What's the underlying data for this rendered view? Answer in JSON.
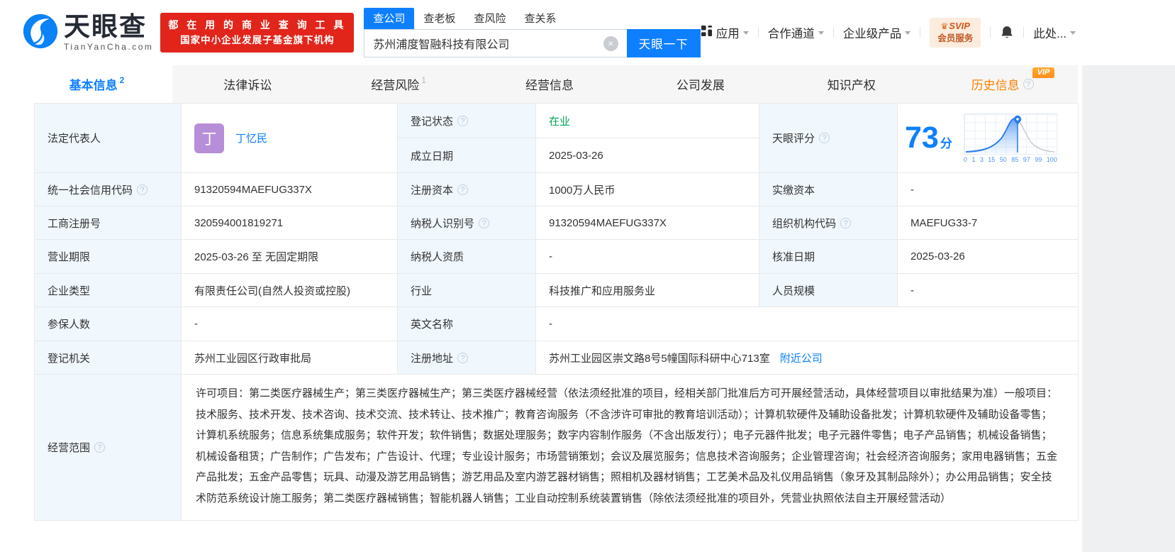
{
  "header": {
    "brand": {
      "name": "天眼查",
      "domain": "TianYanCha.com"
    },
    "promo": {
      "line1": "都 在 用 的 商 业 查 询 工 具",
      "line2": "国家中小企业发展子基金旗下机构"
    },
    "search": {
      "tab_company": "查公司",
      "tab_boss": "查老板",
      "tab_risk": "查风险",
      "tab_relation": "查关系",
      "value": "苏州浦度智融科技有限公司",
      "button": "天眼一下"
    },
    "nav": {
      "apps": "应用",
      "partner": "合作通道",
      "enterprise": "企业级产品",
      "svip_top": "SVIP",
      "svip_bottom": "会员服务",
      "user": "此处..."
    }
  },
  "tabs": {
    "basic": {
      "label": "基本信息",
      "badge": "2"
    },
    "legal": {
      "label": "法律诉讼"
    },
    "risk": {
      "label": "经营风险",
      "badge": "1"
    },
    "operation": {
      "label": "经营信息"
    },
    "development": {
      "label": "公司发展"
    },
    "ip": {
      "label": "知识产权"
    },
    "history": {
      "label": "历史信息",
      "vip": "VIP"
    }
  },
  "fields": {
    "legal_rep": {
      "label": "法定代表人",
      "avatar": "丁",
      "name": "丁忆民"
    },
    "reg_status": {
      "label": "登记状态",
      "value": "在业"
    },
    "establish_date": {
      "label": "成立日期",
      "value": "2025-03-26"
    },
    "score": {
      "label": "天眼评分",
      "value": "73",
      "unit": "分",
      "ticks": [
        "0",
        "1",
        "3",
        "15",
        "50",
        "85",
        "97",
        "99",
        "100"
      ]
    },
    "credit_code": {
      "label": "统一社会信用代码",
      "value": "91320594MAEFUG337X"
    },
    "reg_capital": {
      "label": "注册资本",
      "value": "1000万人民币"
    },
    "paid_capital": {
      "label": "实缴资本",
      "value": "-"
    },
    "reg_no": {
      "label": "工商注册号",
      "value": "320594001819271"
    },
    "taxpayer_id": {
      "label": "纳税人识别号",
      "value": "91320594MAEFUG337X"
    },
    "org_code": {
      "label": "组织机构代码",
      "value": "MAEFUG33-7"
    },
    "term": {
      "label": "营业期限",
      "value": "2025-03-26 至 无固定期限"
    },
    "taxpayer_quality": {
      "label": "纳税人资质",
      "value": "-"
    },
    "approval_date": {
      "label": "核准日期",
      "value": "2025-03-26"
    },
    "company_type": {
      "label": "企业类型",
      "value": "有限责任公司(自然人投资或控股)"
    },
    "industry": {
      "label": "行业",
      "value": "科技推广和应用服务业"
    },
    "staff_size": {
      "label": "人员规模",
      "value": "-"
    },
    "insured": {
      "label": "参保人数",
      "value": "-"
    },
    "english_name": {
      "label": "英文名称",
      "value": "-"
    },
    "authority": {
      "label": "登记机关",
      "value": "苏州工业园区行政审批局"
    },
    "address": {
      "label": "注册地址",
      "value": "苏州工业园区崇文路8号5幢国际科研中心713室",
      "link": "附近公司"
    },
    "scope": {
      "label": "经营范围",
      "value": "许可项目：第二类医疗器械生产；第三类医疗器械生产；第三类医疗器械经营（依法须经批准的项目，经相关部门批准后方可开展经营活动，具体经营项目以审批结果为准）一般项目：技术服务、技术开发、技术咨询、技术交流、技术转让、技术推广；教育咨询服务（不含涉许可审批的教育培训活动）；计算机软硬件及辅助设备批发；计算机软硬件及辅助设备零售；计算机系统服务；信息系统集成服务；软件开发；软件销售；数据处理服务；数字内容制作服务（不含出版发行）；电子元器件批发；电子元器件零售；电子产品销售；机械设备销售；机械设备租赁；广告制作；广告发布；广告设计、代理；专业设计服务；市场营销策划；会议及展览服务；信息技术咨询服务；企业管理咨询；社会经济咨询服务；家用电器销售；五金产品批发；五金产品零售；玩具、动漫及游艺用品销售；游艺用品及室内游艺器材销售；照相机及器材销售；工艺美术品及礼仪用品销售（象牙及其制品除外）；办公用品销售；安全技术防范系统设计施工服务；第二类医疗器械销售；智能机器人销售；工业自动控制系统装置销售（除依法须经批准的项目外，凭营业执照依法自主开展经营活动）"
    }
  },
  "icons": {
    "clear": "×"
  },
  "colors": {
    "primary_blue": "#0e80ff",
    "status_green": "#00a854",
    "history_orange": "#ff8000",
    "promo_red": "#e1251b",
    "avatar_purple": "#b78fd9"
  }
}
